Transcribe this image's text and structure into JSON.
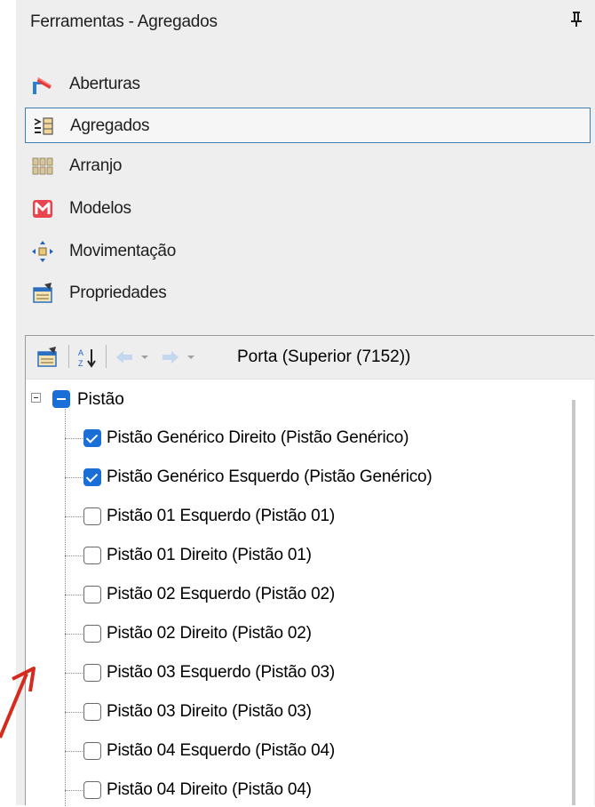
{
  "panel": {
    "title": "Ferramentas - Agregados",
    "pin_glyph": "ᵖ"
  },
  "tools": [
    {
      "label": "Aberturas",
      "icon": "aberturas-icon"
    },
    {
      "label": "Agregados",
      "icon": "agregados-icon",
      "selected": true
    },
    {
      "label": "Arranjo",
      "icon": "arranjo-icon"
    },
    {
      "label": "Modelos",
      "icon": "modelos-icon"
    },
    {
      "label": "Movimentação",
      "icon": "movimentacao-icon"
    },
    {
      "label": "Propriedades",
      "icon": "propriedades-icon"
    }
  ],
  "grid": {
    "object_name": "Porta (Superior (7152))",
    "root": {
      "label": "Pistão",
      "state": "indeterminate",
      "expanded": true
    },
    "items": [
      {
        "label": "Pistão Genérico Direito (Pistão Genérico)",
        "checked": true
      },
      {
        "label": "Pistão Genérico Esquerdo (Pistão Genérico)",
        "checked": true
      },
      {
        "label": "Pistão 01 Esquerdo (Pistão 01)",
        "checked": false
      },
      {
        "label": "Pistão 01 Direito (Pistão 01)",
        "checked": false
      },
      {
        "label": "Pistão 02 Esquerdo (Pistão 02)",
        "checked": false
      },
      {
        "label": "Pistão 02 Direito (Pistão 02)",
        "checked": false
      },
      {
        "label": "Pistão 03 Esquerdo (Pistão 03)",
        "checked": false
      },
      {
        "label": "Pistão 03 Direito (Pistão 03)",
        "checked": false
      },
      {
        "label": "Pistão 04 Esquerdo (Pistão 04)",
        "checked": false
      },
      {
        "label": "Pistão 04 Direito (Pistão 04)",
        "checked": false
      }
    ]
  },
  "colors": {
    "accent": "#1a6ed8",
    "selection_border": "#3c7fb1",
    "arrow": "#d42b1e"
  }
}
